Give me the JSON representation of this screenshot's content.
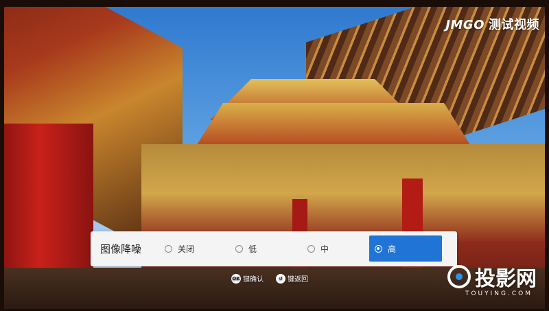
{
  "brand": {
    "name": "JMGO",
    "tag": "测试视频"
  },
  "watermark": {
    "name": "投影网",
    "sub": "TOUYING.COM"
  },
  "noise_reduction": {
    "title": "图像降噪",
    "options": [
      {
        "label": "关闭",
        "selected": false
      },
      {
        "label": "低",
        "selected": false
      },
      {
        "label": "中",
        "selected": false
      },
      {
        "label": "高",
        "selected": true
      }
    ]
  },
  "hints": {
    "confirm_key": "OK",
    "confirm_label": "键确认",
    "back_key": "↺",
    "back_label": "键返回"
  },
  "colors": {
    "accent": "#1f74d6",
    "bar_bg": "#f4f4f4"
  }
}
